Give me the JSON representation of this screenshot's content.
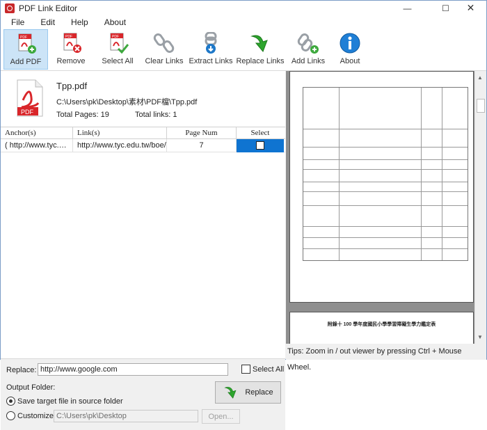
{
  "window": {
    "title": "PDF Link Editor"
  },
  "menu": [
    "File",
    "Edit",
    "Help",
    "About"
  ],
  "toolbar": {
    "add_pdf": "Add PDF",
    "remove": "Remove",
    "select_all": "Select All",
    "clear_links": "Clear Links",
    "extract_links": "Extract Links",
    "replace_links": "Replace Links",
    "add_links": "Add Links",
    "about": "About"
  },
  "file": {
    "name": "Tpp.pdf",
    "path": "C:\\Users\\pk\\Desktop\\素材\\PDF檔\\Tpp.pdf",
    "total_pages": "Total Pages: 19",
    "total_links": "Total links: 1"
  },
  "table": {
    "headers": {
      "anchor": "Anchor(s)",
      "link": "Link(s)",
      "page": "Page Num",
      "select": "Select"
    },
    "rows": [
      {
        "anchor": "( http://www.tyc.…",
        "link": "http://www.tyc.edu.tw/boe/main.…",
        "page": "7"
      }
    ]
  },
  "replace": {
    "label": "Replace:",
    "value": "http://www.google.com",
    "select_all": "Select All",
    "button": "Replace"
  },
  "output": {
    "label": "Output Folder:",
    "opt_source": "Save target file in source folder",
    "opt_custom": "Customize:",
    "custom_path": "C:\\Users\\pk\\Desktop",
    "open": "Open..."
  },
  "viewer": {
    "tips": "Tips: Zoom in / out viewer by pressing Ctrl + Mouse Wheel.",
    "page2_heading": "附錄十 100 學年度國民小學學習障礙生學力鑑定表"
  }
}
